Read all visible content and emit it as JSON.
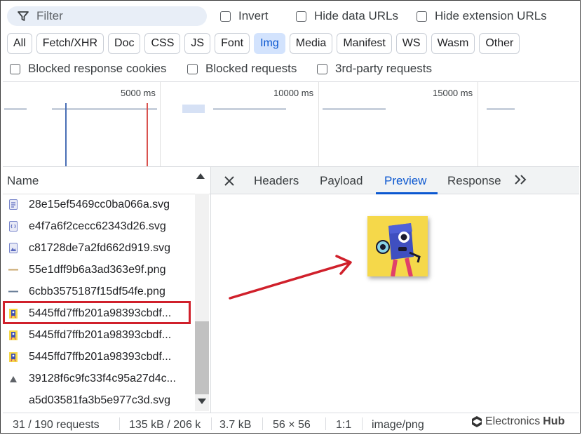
{
  "filter": {
    "placeholder": "Filter",
    "icon": "filter-icon"
  },
  "options_row1": [
    {
      "label": "Invert"
    },
    {
      "label": "Hide data URLs"
    },
    {
      "label": "Hide extension URLs"
    }
  ],
  "type_filters": [
    {
      "label": "All",
      "active": false
    },
    {
      "label": "Fetch/XHR",
      "active": false
    },
    {
      "label": "Doc",
      "active": false
    },
    {
      "label": "CSS",
      "active": false
    },
    {
      "label": "JS",
      "active": false
    },
    {
      "label": "Font",
      "active": false
    },
    {
      "label": "Img",
      "active": true
    },
    {
      "label": "Media",
      "active": false
    },
    {
      "label": "Manifest",
      "active": false
    },
    {
      "label": "WS",
      "active": false
    },
    {
      "label": "Wasm",
      "active": false
    },
    {
      "label": "Other",
      "active": false
    }
  ],
  "options_row2": [
    {
      "label": "Blocked response cookies"
    },
    {
      "label": "Blocked requests"
    },
    {
      "label": "3rd-party requests"
    }
  ],
  "timeline": {
    "labels": [
      "5000 ms",
      "10000 ms",
      "15000 ms"
    ]
  },
  "requests": {
    "column_header": "Name",
    "rows": [
      {
        "name": "28e15ef5469cc0ba066a.svg",
        "icon": "svg-file-icon"
      },
      {
        "name": "e4f7a6f2cecc62343d26.svg",
        "icon": "svg-file-icon"
      },
      {
        "name": "c81728de7a2fd662d919.svg",
        "icon": "svg-file-icon"
      },
      {
        "name": "55e1dff9b6a3ad363e9f.png",
        "icon": "png-line-icon"
      },
      {
        "name": "6cbb3575187f15df54fe.png",
        "icon": "png-line-icon"
      },
      {
        "name": "5445ffd7ffb201a98393cbdf...",
        "icon": "image-thumbnail-icon",
        "selected": true
      },
      {
        "name": "5445ffd7ffb201a98393cbdf...",
        "icon": "image-thumbnail-icon"
      },
      {
        "name": "5445ffd7ffb201a98393cbdf...",
        "icon": "image-thumbnail-icon"
      },
      {
        "name": "39128f6c9fc33f4c95a27d4c...",
        "icon": "image-small-icon"
      },
      {
        "name": "a5d03581fa3b5e977c3d.svg",
        "icon": "blank-file-icon"
      }
    ]
  },
  "detail_tabs": [
    {
      "label": "Headers"
    },
    {
      "label": "Payload"
    },
    {
      "label": "Preview",
      "active": true
    },
    {
      "label": "Response"
    }
  ],
  "status": {
    "requests": "31 / 190 requests",
    "transferred": "135 kB / 206 k",
    "size": "3.7 kB",
    "dimensions": "56 × 56",
    "ratio": "1:1",
    "mime": "image/png"
  },
  "watermark": {
    "brand": "Electronics",
    "suffix": "Hub"
  },
  "colors": {
    "accent": "#0b57d0",
    "highlight": "#d0202b",
    "preview_bg": "#f5d84a"
  }
}
